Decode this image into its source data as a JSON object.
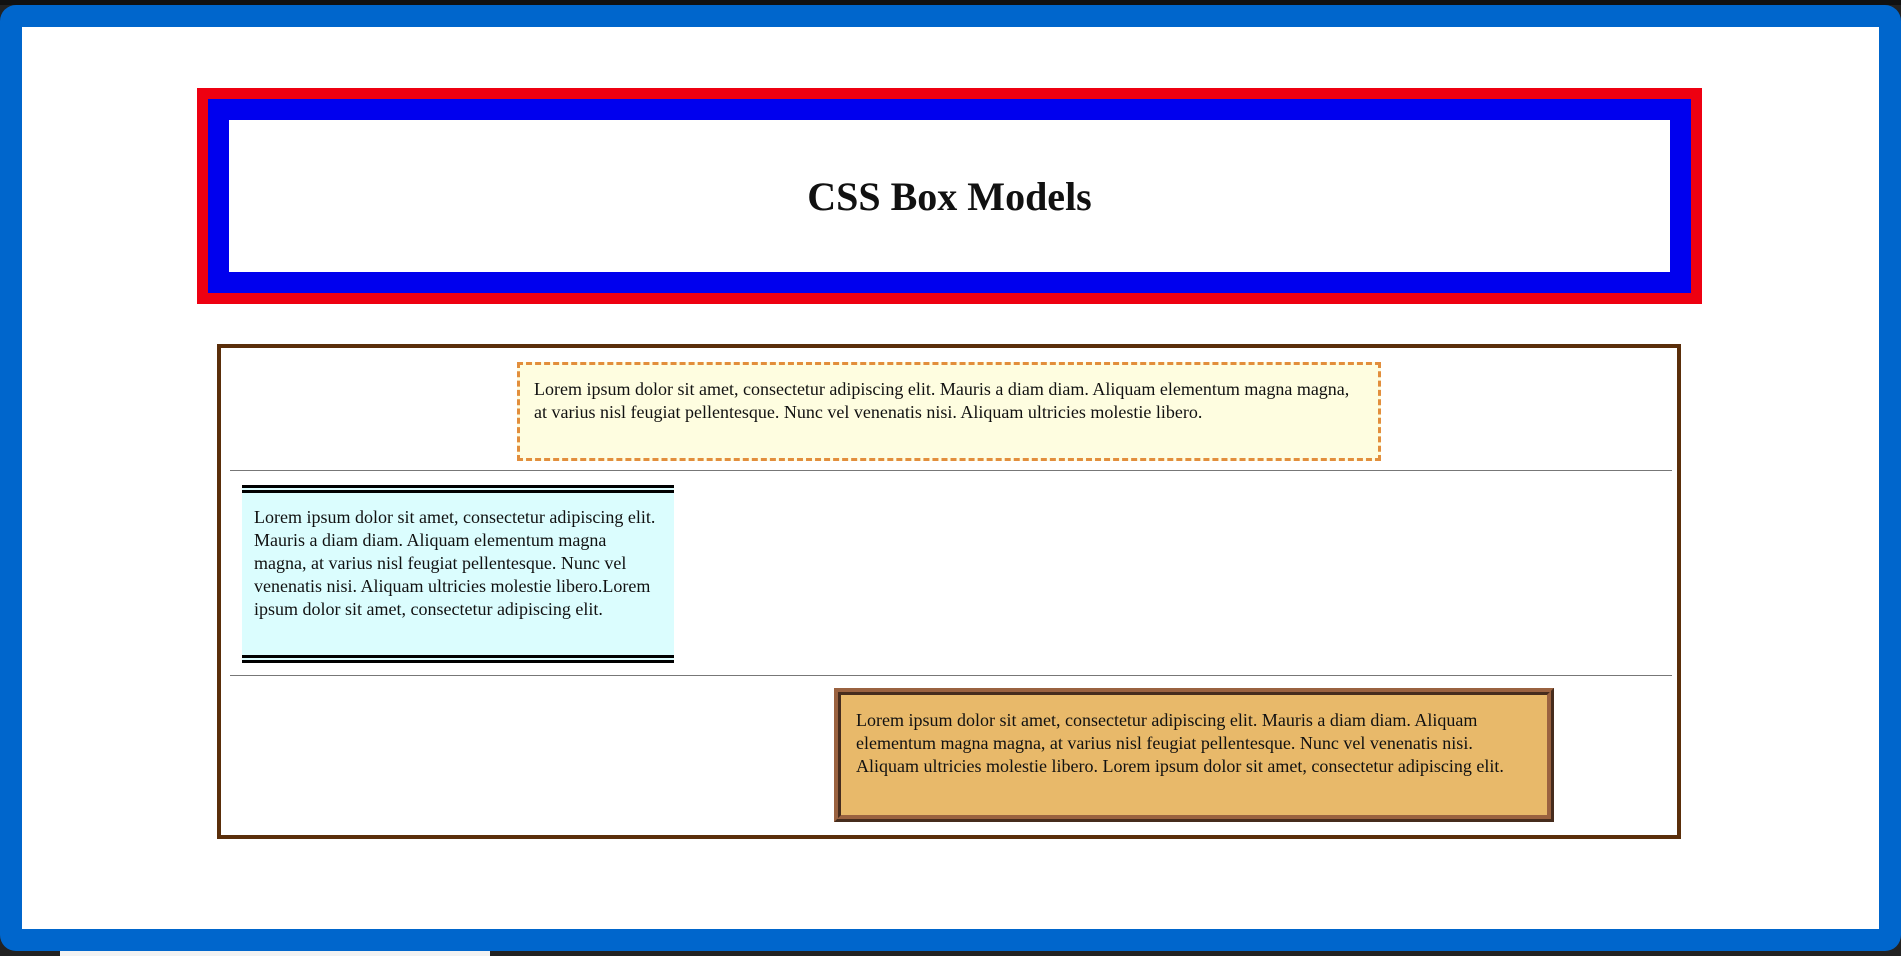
{
  "page": {
    "title": "CSS Box Models"
  },
  "boxes": {
    "top_text": "Lorem ipsum dolor sit amet, consectetur adipiscing elit. Mauris a diam diam. Aliquam elementum magna magna, at varius nisl feugiat pellentesque. Nunc vel venenatis nisi. Aliquam ultricies molestie libero.",
    "middle_text": "Lorem ipsum dolor sit amet, consectetur adipiscing elit. Mauris a diam diam. Aliquam elementum magna magna, at varius nisl feugiat pellentesque. Nunc vel venenatis nisi. Aliquam ultricies molestie libero.Lorem ipsum dolor sit amet, consectetur adipiscing elit.",
    "bottom_text": "Lorem ipsum dolor sit amet, consectetur adipiscing elit. Mauris a diam diam. Aliquam elementum magna magna, at varius nisl feugiat pellentesque. Nunc vel venenatis nisi. Aliquam ultricies molestie libero. Lorem ipsum dolor sit amet, consectetur adipiscing elit."
  },
  "colors": {
    "frame_border": "#0066cc",
    "header_outer_border": "#ee0011",
    "header_inner_border": "#0000ee",
    "container_border": "#5a2e0a",
    "box1_border": "#e28e3c",
    "box1_background": "#fefde0",
    "box2_border": "#000000",
    "box2_background": "#dbfdfe",
    "box3_border": "#9a6240",
    "box3_background": "#e8b96a"
  }
}
